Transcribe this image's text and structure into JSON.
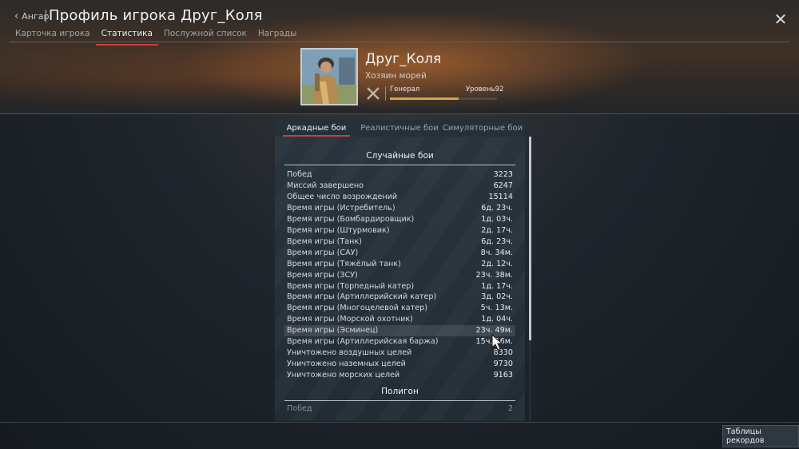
{
  "header": {
    "back_label": "Ангар",
    "title": "Профиль игрока Друг_Коля",
    "tabs": [
      {
        "label": "Карточка игрока"
      },
      {
        "label": "Статистика"
      },
      {
        "label": "Послужной список"
      },
      {
        "label": "Награды"
      }
    ],
    "active_tab": "Статистика"
  },
  "profile": {
    "nickname": "Друг_Коля",
    "title": "Хозяин морей",
    "rank": "Генерал",
    "level": "Уровень92",
    "level_progress_fraction": 0.64
  },
  "mode_tabs": [
    {
      "label": "Аркадные бои"
    },
    {
      "label": "Реалистичные бои"
    },
    {
      "label": "Симуляторные бои"
    }
  ],
  "stats": {
    "random_title": "Случайные бои",
    "random_rows": [
      {
        "label": "Побед",
        "value": "3223"
      },
      {
        "label": "Миссий завершено",
        "value": "6247"
      },
      {
        "label": "Общее число возрождений",
        "value": "15114"
      },
      {
        "label": "Время игры (Истребитель)",
        "value": "6д. 23ч."
      },
      {
        "label": "Время игры (Бомбардировщик)",
        "value": "1д. 03ч."
      },
      {
        "label": "Время игры (Штурмовик)",
        "value": "2д. 17ч."
      },
      {
        "label": "Время игры (Танк)",
        "value": "6д. 23ч."
      },
      {
        "label": "Время игры (САУ)",
        "value": "8ч. 34м."
      },
      {
        "label": "Время игры (Тяжёлый танк)",
        "value": "2д. 12ч."
      },
      {
        "label": "Время игры (ЗСУ)",
        "value": "23ч. 38м."
      },
      {
        "label": "Время игры (Торпедный катер)",
        "value": "1д. 17ч."
      },
      {
        "label": "Время игры (Артиллерийский катер)",
        "value": "3д. 02ч."
      },
      {
        "label": "Время игры (Многоцелевой катер)",
        "value": "5ч. 13м."
      },
      {
        "label": "Время игры (Морской охотник)",
        "value": "1д. 04ч."
      },
      {
        "label": "Время игры (Эсминец)",
        "value": "23ч. 49м."
      },
      {
        "label": "Время игры (Артиллерийская баржа)",
        "value": "15ч. 16м."
      },
      {
        "label": "Уничтожено воздушных целей",
        "value": "8330"
      },
      {
        "label": "Уничтожено наземных целей",
        "value": "9730"
      },
      {
        "label": "Уничтожено морских целей",
        "value": "9163"
      }
    ],
    "polygon_title": "Полигон",
    "polygon_rows": [
      {
        "label": "Побед",
        "value": "2"
      }
    ]
  },
  "footer": {
    "records_label": "Таблицы рекордов"
  }
}
